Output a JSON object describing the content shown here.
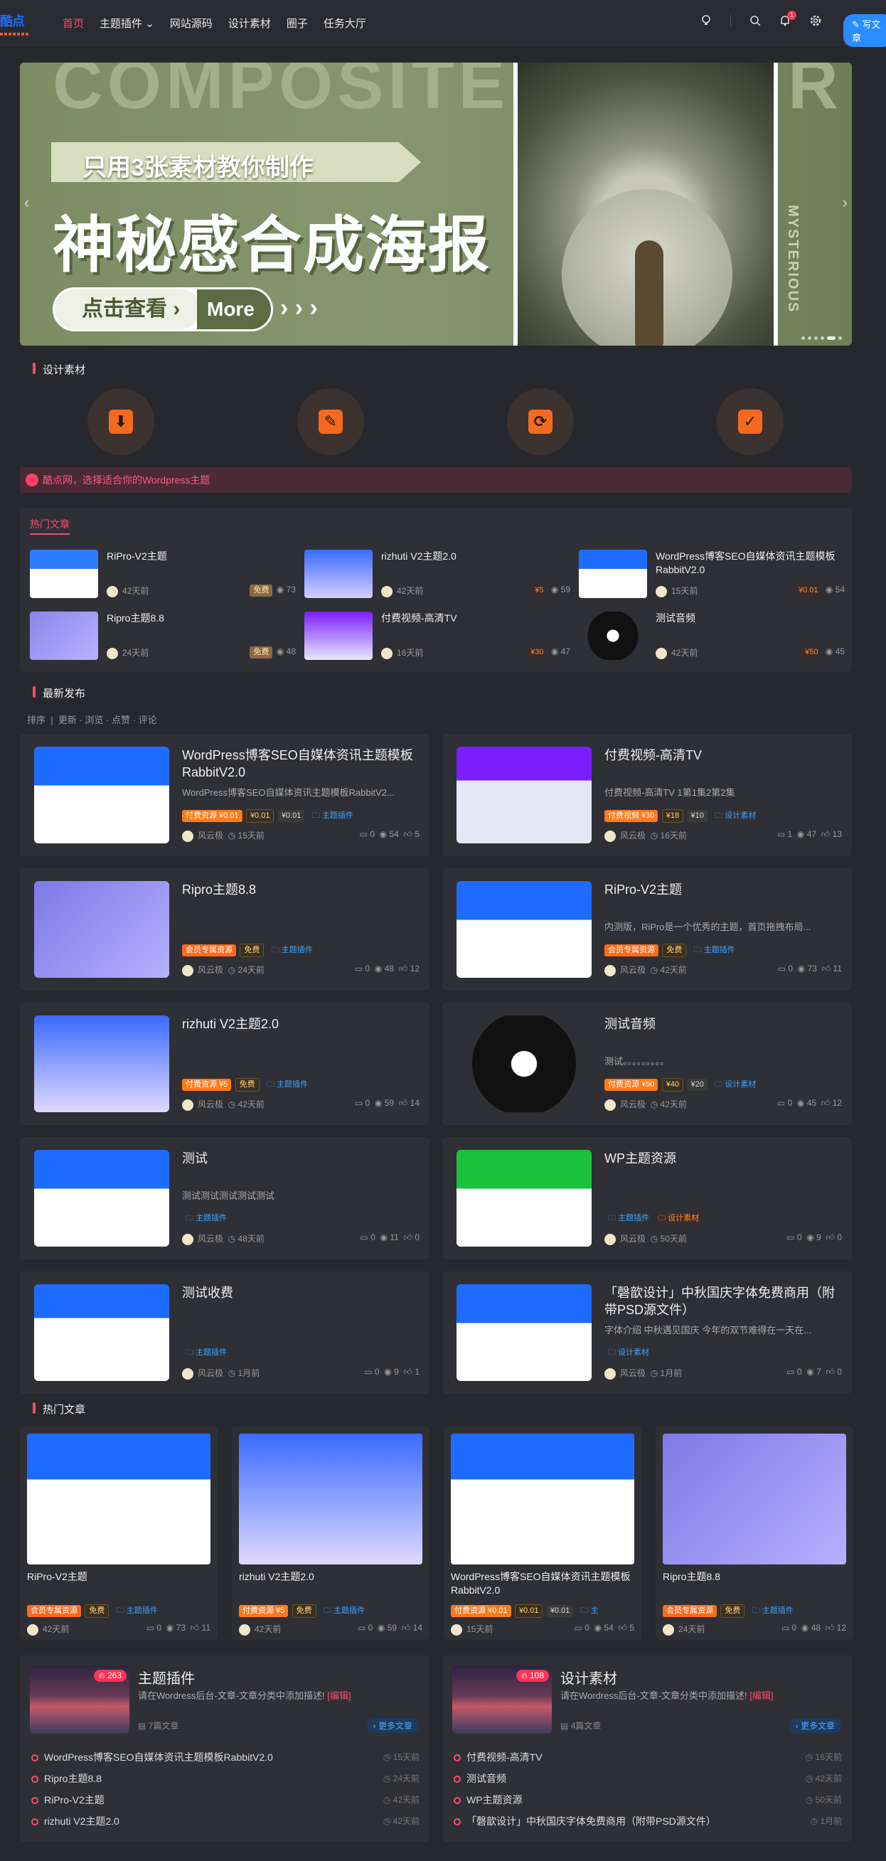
{
  "header": {
    "logo_text": "酷点",
    "nav": [
      "首页",
      "主题插件",
      "网站源码",
      "设计素材",
      "圈子",
      "任务大厅"
    ],
    "notification_count": "1",
    "write_label": "写文章"
  },
  "banner": {
    "bg_word": "COMPOSITE",
    "bg_word_end": "R",
    "subtitle": "只用3张素材教你制作",
    "title": "神秘感合成海报",
    "btn_left": "点击查看 ›",
    "btn_right": "More",
    "arrows": "› › ›",
    "side_word": "MYSTERIOUS",
    "prev": "‹",
    "next": "›"
  },
  "section_design": "设计素材",
  "notice": "酷点网，选择适合你的Wordpress主题",
  "hot_panel": {
    "title": "热门文章",
    "items": [
      {
        "title": "RiPro-V2主题",
        "date": "42天前",
        "tag": "免费",
        "views": "73"
      },
      {
        "title": "rizhuti V2主题2.0",
        "date": "42天前",
        "tag": "¥5",
        "views": "59"
      },
      {
        "title": "WordPress博客SEO自媒体资讯主题模板RabbitV2.0",
        "date": "15天前",
        "tag": "¥0.01",
        "views": "54"
      },
      {
        "title": "Ripro主题8.8",
        "date": "24天前",
        "tag": "免费",
        "views": "48"
      },
      {
        "title": "付费视频-高清TV",
        "date": "16天前",
        "tag": "¥30",
        "views": "47"
      },
      {
        "title": "测试音频",
        "date": "42天前",
        "tag": "¥50",
        "views": "45"
      }
    ]
  },
  "section_latest": "最新发布",
  "sort": {
    "label": "排序",
    "options": [
      "更新",
      "浏览",
      "点赞",
      "评论"
    ]
  },
  "author": "风云极",
  "cards": [
    {
      "title": "WordPress博客SEO自媒体资讯主题模板RabbitV2.0",
      "desc": "WordPress博客SEO自媒体资讯主题模板RabbitV2...",
      "tags": [
        "付费资源 ¥0.01",
        "¥0.01",
        "¥0.01"
      ],
      "cat": "主题插件",
      "date": "15天前",
      "c": "0",
      "v": "54",
      "l": "5"
    },
    {
      "title": "付费视频-高清TV",
      "desc": "付费视频-高清TV 1第1集2第2集",
      "tags": [
        "付费视频 ¥30",
        "¥18",
        "¥10"
      ],
      "cat": "设计素材",
      "date": "16天前",
      "c": "1",
      "v": "47",
      "l": "13"
    },
    {
      "title": "Ripro主题8.8",
      "desc": "",
      "tags": [
        "会员专属资源",
        "免费"
      ],
      "cat": "主题插件",
      "date": "24天前",
      "c": "0",
      "v": "48",
      "l": "12"
    },
    {
      "title": "RiPro-V2主题",
      "desc": "内测版，RiPro是一个优秀的主题，首页拖拽布局...",
      "tags": [
        "会员专属资源",
        "免费"
      ],
      "cat": "主题插件",
      "date": "42天前",
      "c": "0",
      "v": "73",
      "l": "11"
    },
    {
      "title": "rizhuti V2主题2.0",
      "desc": "",
      "tags": [
        "付费资源 ¥5",
        "免费"
      ],
      "cat": "主题插件",
      "date": "42天前",
      "c": "0",
      "v": "59",
      "l": "14"
    },
    {
      "title": "测试音频",
      "desc": "测试。。。。。。。。。",
      "tags": [
        "付费资源 ¥50",
        "¥40",
        "¥20"
      ],
      "cat": "设计素材",
      "date": "42天前",
      "c": "0",
      "v": "45",
      "l": "12"
    },
    {
      "title": "测试",
      "desc": "测试测试测试测试测试",
      "tags": [],
      "cat": "主题插件",
      "date": "48天前",
      "c": "0",
      "v": "11",
      "l": "0"
    },
    {
      "title": "WP主题资源",
      "desc": "",
      "tags": [],
      "cat": "主题插件",
      "cat2": "设计素材",
      "date": "50天前",
      "c": "0",
      "v": "9",
      "l": "0"
    },
    {
      "title": "测试收费",
      "desc": "",
      "tags": [],
      "cat": "主题插件",
      "date": "1月前",
      "c": "0",
      "v": "9",
      "l": "1"
    },
    {
      "title": "「磬歆设计」中秋国庆字体免费商用（附带PSD源文件）",
      "desc": "字体介绍 中秋遇见国庆 今年的双节难得在一天在...",
      "tags": [],
      "cat": "设计素材",
      "date": "1月前",
      "c": "0",
      "v": "7",
      "l": "0"
    }
  ],
  "section_hot": "热门文章",
  "grid": [
    {
      "title": "RiPro-V2主题",
      "tags": [
        "会员专属资源",
        "免费"
      ],
      "cat": "主题插件",
      "date": "42天前",
      "c": "0",
      "v": "73",
      "l": "11"
    },
    {
      "title": "rizhuti V2主题2.0",
      "tags": [
        "付费资源 ¥5",
        "免费"
      ],
      "cat": "主题插件",
      "date": "42天前",
      "c": "0",
      "v": "59",
      "l": "14"
    },
    {
      "title": "WordPress博客SEO自媒体资讯主题模板RabbitV2.0",
      "tags": [
        "付费资源 ¥0.01",
        "¥0.01",
        "¥0.01"
      ],
      "cat": "主",
      "date": "15天前",
      "c": "0",
      "v": "54",
      "l": "5"
    },
    {
      "title": "Ripro主题8.8",
      "tags": [
        "会员专属资源",
        "免费"
      ],
      "cat": "主题插件",
      "date": "24天前",
      "c": "0",
      "v": "48",
      "l": "12"
    }
  ],
  "categories": [
    {
      "name": "主题插件",
      "count_badge": "263",
      "desc": "请在Wordress后台-文章-文章分类中添加描述!",
      "edit": "[编辑]",
      "count": "7篇文章",
      "more": "更多文章",
      "list": [
        [
          "WordPress博客SEO自媒体资讯主题模板RabbitV2.0",
          "15天前"
        ],
        [
          "Ripro主题8.8",
          "24天前"
        ],
        [
          "RiPro-V2主题",
          "42天前"
        ],
        [
          "rizhuti V2主题2.0",
          "42天前"
        ]
      ]
    },
    {
      "name": "设计素材",
      "count_badge": "108",
      "desc": "请在Wordress后台-文章-文章分类中添加描述!",
      "edit": "[编辑]",
      "count": "4篇文章",
      "more": "更多文章",
      "list": [
        [
          "付费视频-高清TV",
          "16天前"
        ],
        [
          "测试音频",
          "42天前"
        ],
        [
          "WP主题资源",
          "50天前"
        ],
        [
          "「磬歆设计」中秋国庆字体免费商用（附带PSD源文件）",
          "1月前"
        ]
      ]
    }
  ]
}
